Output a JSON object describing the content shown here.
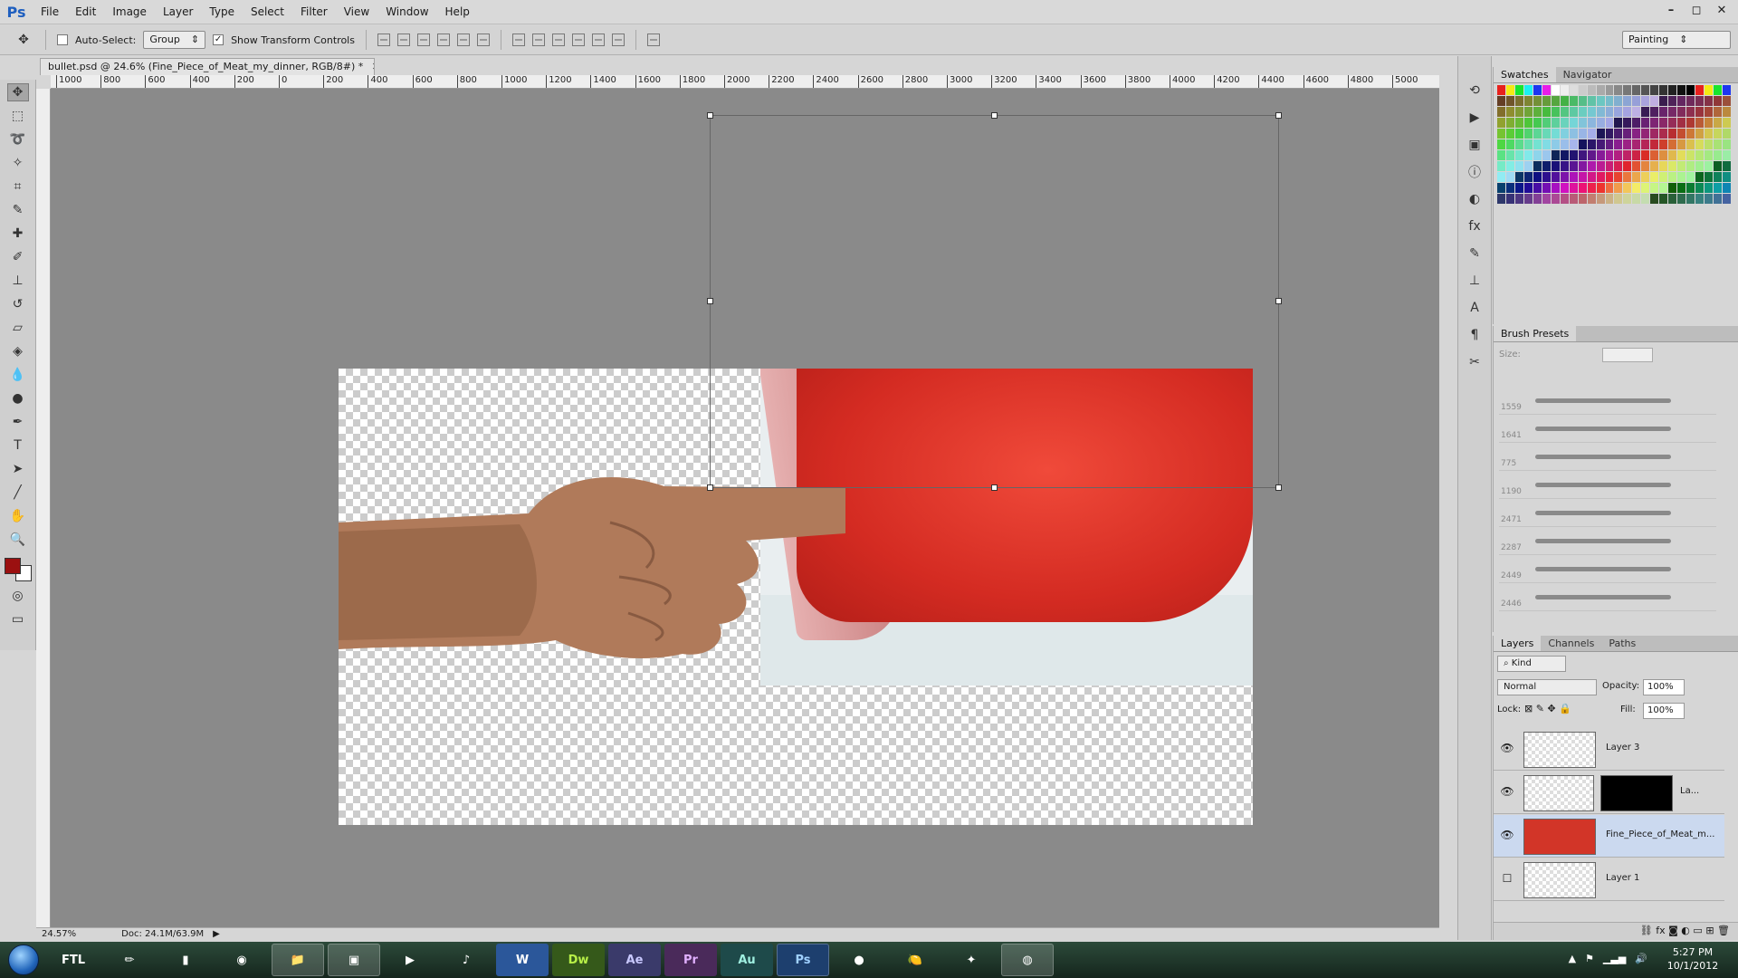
{
  "app": {
    "logo": "Ps",
    "menus": [
      "File",
      "Edit",
      "Image",
      "Layer",
      "Type",
      "Select",
      "Filter",
      "View",
      "Window",
      "Help"
    ],
    "window_controls": [
      "–",
      "◻",
      "✕"
    ]
  },
  "options_bar": {
    "auto_select_label": "Auto-Select:",
    "auto_select_mode": "Group",
    "show_transform_label": "Show Transform Controls",
    "workspace": "Painting"
  },
  "document": {
    "tab_title": "bullet.psd @ 24.6% (Fine_Piece_of_Meat_my_dinner, RGB/8#) *",
    "zoom": "24.57%",
    "doc_size": "Doc: 24.1M/63.9M",
    "ruler_ticks": [
      "1000",
      "800",
      "600",
      "400",
      "200",
      "0",
      "200",
      "400",
      "600",
      "800",
      "1000",
      "1200",
      "1400",
      "1600",
      "1800",
      "2000",
      "2200",
      "2400",
      "2600",
      "2800",
      "3000",
      "3200",
      "3400",
      "3600",
      "3800",
      "4000",
      "4200",
      "4400",
      "4600",
      "4800",
      "5000"
    ]
  },
  "panels": {
    "swatches_tab": "Swatches",
    "navigator_tab": "Navigator",
    "brush_presets_tab": "Brush Presets",
    "size_label": "Size:",
    "brush_sizes": [
      "1559",
      "1641",
      "775",
      "1190",
      "2471",
      "2287",
      "2449",
      "2446"
    ],
    "layers_tab": "Layers",
    "channels_tab": "Channels",
    "paths_tab": "Paths",
    "kind_label": "Kind",
    "blend_mode": "Normal",
    "opacity_label": "Opacity:",
    "opacity_value": "100%",
    "lock_label": "Lock:",
    "fill_label": "Fill:",
    "fill_value": "100%",
    "layers": [
      {
        "name": "Layer 3"
      },
      {
        "name": "La..."
      },
      {
        "name": "Fine_Piece_of_Meat_m..."
      },
      {
        "name": "Layer 1"
      }
    ]
  },
  "taskbar": {
    "apps": [
      "FTL",
      "Dw",
      "Ae",
      "Pr",
      "Au",
      "Ps"
    ],
    "time": "5:27 PM",
    "date": "10/1/2012"
  },
  "colors": {
    "foreground": "#9b1010",
    "accent": "#1f5fbf"
  }
}
